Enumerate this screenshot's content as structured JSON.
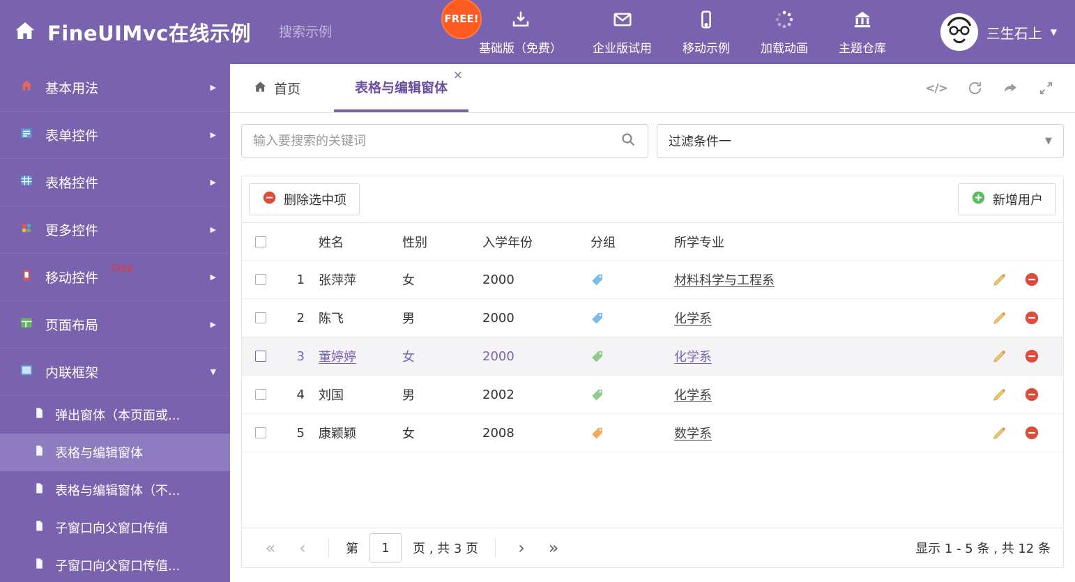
{
  "colors": {
    "accent": "#7a63ae",
    "sidebar_active": "#8e7cc0",
    "free_badge": "#ff5a1f",
    "delete_red": "#dd4b39",
    "add_green": "#5cb85c",
    "tag_blue": "#7bbde8",
    "tag_green": "#8ecb8e",
    "tag_orange": "#f2a95f"
  },
  "icons": {
    "chevron_right": "▶",
    "chevron_down": "▼",
    "caret_down": "▼",
    "close": "×",
    "code": "</>",
    "pager_first": "«",
    "pager_prev": "‹",
    "pager_next": "›",
    "pager_last": "»"
  },
  "header": {
    "title": "FineUIMvc在线示例",
    "search_placeholder": "搜索示例",
    "free_badge": "FREE!",
    "nav": [
      "基础版（免费）",
      "企业版试用",
      "移动示例",
      "加载动画",
      "主题仓库"
    ],
    "user_name": "三生石上"
  },
  "sidebar": {
    "items": [
      {
        "label": "基本用法"
      },
      {
        "label": "表单控件"
      },
      {
        "label": "表格控件"
      },
      {
        "label": "更多控件"
      },
      {
        "label": "移动控件",
        "badge": "Corp."
      },
      {
        "label": "页面布局"
      },
      {
        "label": "内联框架"
      }
    ],
    "subitems": [
      {
        "label": "弹出窗体（本页面或..."
      },
      {
        "label": "表格与编辑窗体",
        "active": true
      },
      {
        "label": "表格与编辑窗体（不..."
      },
      {
        "label": "子窗口向父窗口传值"
      },
      {
        "label": "子窗口向父窗口传值..."
      }
    ]
  },
  "tabs": [
    {
      "label": "首页"
    },
    {
      "label": "表格与编辑窗体",
      "active": true
    }
  ],
  "filter": {
    "search_placeholder": "输入要搜索的关键词",
    "dropdown_value": "过滤条件一"
  },
  "toolbar": {
    "delete_label": "删除选中项",
    "add_label": "新增用户"
  },
  "table": {
    "headers": [
      "姓名",
      "性别",
      "入学年份",
      "分组",
      "所学专业"
    ],
    "rows": [
      {
        "num": "1",
        "name": "张萍萍",
        "gender": "女",
        "year": "2000",
        "tag": "blue",
        "major": "材料科学与工程系"
      },
      {
        "num": "2",
        "name": "陈飞",
        "gender": "男",
        "year": "2000",
        "tag": "blue",
        "major": "化学系"
      },
      {
        "num": "3",
        "name": "董婷婷",
        "gender": "女",
        "year": "2000",
        "tag": "green",
        "major": "化学系",
        "selected": true
      },
      {
        "num": "4",
        "name": "刘国",
        "gender": "男",
        "year": "2002",
        "tag": "green",
        "major": "化学系"
      },
      {
        "num": "5",
        "name": "康颖颖",
        "gender": "女",
        "year": "2008",
        "tag": "orange",
        "major": "数学系"
      }
    ]
  },
  "pager": {
    "label_page": "第",
    "page": "1",
    "label_total": "页 , 共 3 页",
    "summary": "显示 1 - 5 条 , 共 12 条"
  }
}
